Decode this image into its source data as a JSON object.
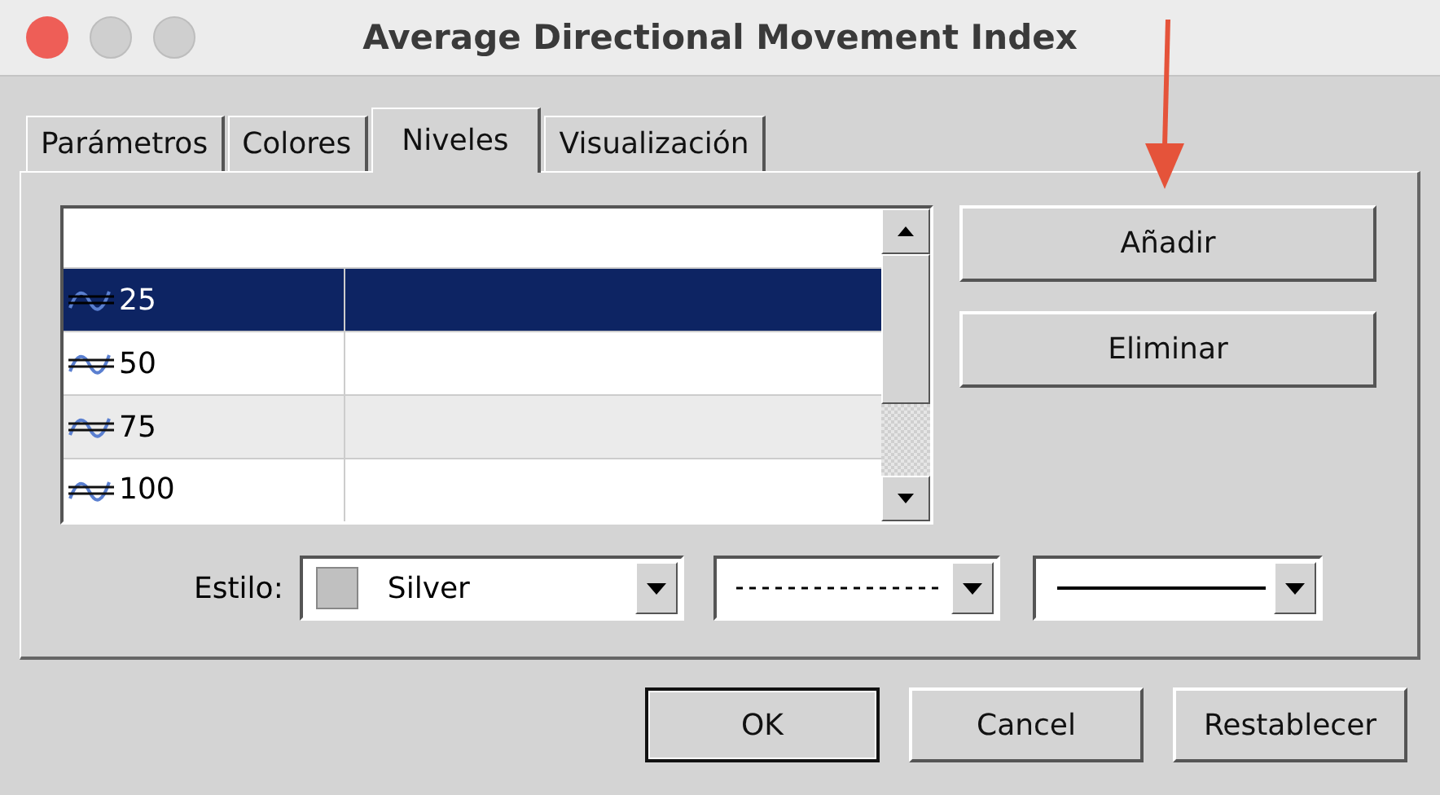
{
  "window": {
    "title": "Average Directional Movement Index"
  },
  "tabs": [
    {
      "label": "Parámetros",
      "selected": false
    },
    {
      "label": "Colores",
      "selected": false
    },
    {
      "label": "Niveles",
      "selected": true
    },
    {
      "label": "Visualización",
      "selected": false
    }
  ],
  "levels": [
    {
      "value": "25",
      "selected": true,
      "hovered": false
    },
    {
      "value": "50",
      "selected": false,
      "hovered": false
    },
    {
      "value": "75",
      "selected": false,
      "hovered": true
    },
    {
      "value": "100",
      "selected": false,
      "hovered": false
    }
  ],
  "side_buttons": [
    "Añadir",
    "Eliminar"
  ],
  "style": {
    "label": "Estilo:",
    "color_name": "Silver",
    "color": "#c0c0c0",
    "line_dropdowns": [
      {
        "kind": "dashed"
      },
      {
        "kind": "solid"
      }
    ]
  },
  "buttons": [
    {
      "label": "OK",
      "default": true
    },
    {
      "label": "Cancel",
      "default": false
    },
    {
      "label": "Restablecer",
      "default": false
    }
  ]
}
